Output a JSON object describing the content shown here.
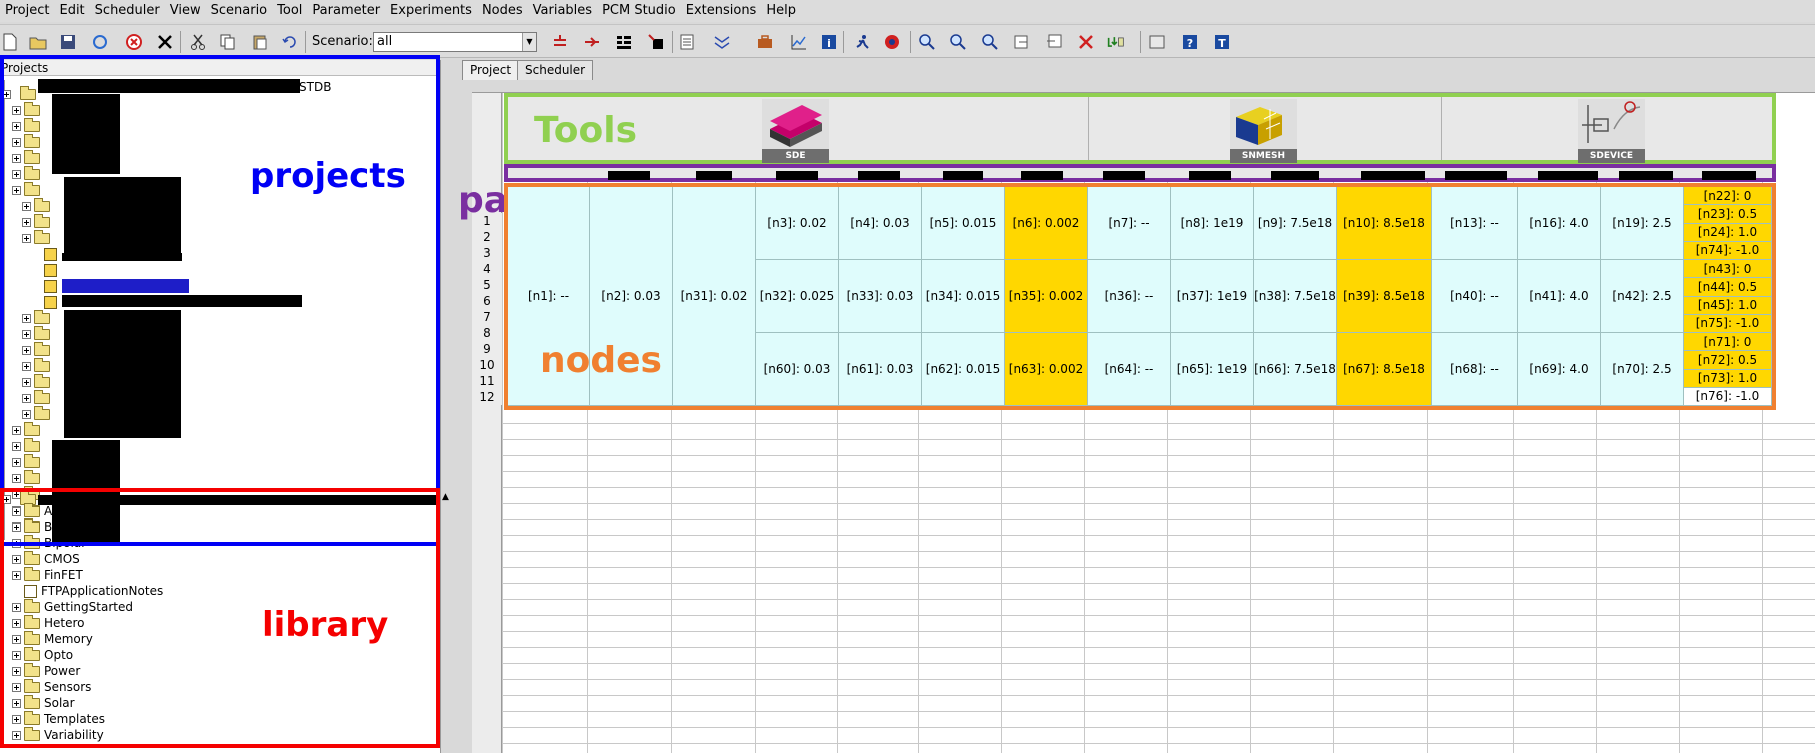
{
  "menu": [
    "Project",
    "Edit",
    "Scheduler",
    "View",
    "Scenario",
    "Tool",
    "Parameter",
    "Experiments",
    "Nodes",
    "Variables",
    "PCM Studio",
    "Extensions",
    "Help"
  ],
  "toolbar": {
    "scenario_label": "Scenario:",
    "scenario_value": "all"
  },
  "projects_pane": {
    "header": "Projects",
    "root_suffix": "STDB"
  },
  "library": {
    "items": [
      "Analog",
      "Backend",
      "Bipolar",
      "CMOS",
      "FinFET",
      "FTPApplicationNotes",
      "GettingStarted",
      "Hetero",
      "Memory",
      "Opto",
      "Power",
      "Sensors",
      "Solar",
      "Templates",
      "Variability"
    ]
  },
  "tabs": [
    "Project",
    "Scheduler"
  ],
  "overlays": {
    "projects": "projects",
    "library": "library",
    "tools": "Tools",
    "parameters": "parameters",
    "nodes": "nodes"
  },
  "colors": {
    "projects": "#0000f5",
    "library": "#f50000",
    "tools": "#90d050",
    "parameters": "#7a2fa0",
    "nodes": "#f08030",
    "node_bg": "#dffcfc",
    "node_highlight": "#ffd700"
  },
  "tools": [
    {
      "label": "SDE",
      "icon": "sde-icon"
    },
    {
      "label": "SNMESH",
      "icon": "snmesh-icon"
    },
    {
      "label": "SDEVICE",
      "icon": "sdevice-icon"
    }
  ],
  "row_numbers": [
    "1",
    "2",
    "3",
    "4",
    "5",
    "6",
    "7",
    "8",
    "9",
    "10",
    "11",
    "12"
  ],
  "nodes": {
    "n1": "[n1]: --",
    "n2": "[n2]: 0.03",
    "n31": "[n31]: 0.02",
    "row1": [
      "[n3]: 0.02",
      "[n4]: 0.03",
      "[n5]: 0.015",
      "[n6]: 0.002",
      "[n7]: --",
      "[n8]: 1e19",
      "[n9]: 7.5e18",
      "[n10]: 8.5e18",
      "[n13]: --",
      "[n16]: 4.0",
      "[n19]: 2.5"
    ],
    "row2": [
      "[n32]: 0.025",
      "[n33]: 0.03",
      "[n34]: 0.015",
      "[n35]: 0.002",
      "[n36]: --",
      "[n37]: 1e19",
      "[n38]: 7.5e18",
      "[n39]: 8.5e18",
      "[n40]: --",
      "[n41]: 4.0",
      "[n42]: 2.5"
    ],
    "row3": [
      "[n60]: 0.03",
      "[n61]: 0.03",
      "[n62]: 0.015",
      "[n63]: 0.002",
      "[n64]: --",
      "[n65]: 1e19",
      "[n66]: 7.5e18",
      "[n67]: 8.5e18",
      "[n68]: --",
      "[n69]: 4.0",
      "[n70]: 2.5"
    ],
    "last": [
      "[n22]: 0",
      "[n23]: 0.5",
      "[n24]: 1.0",
      "[n74]: -1.0",
      "[n43]: 0",
      "[n44]: 0.5",
      "[n45]: 1.0",
      "[n75]: -1.0",
      "[n71]: 0",
      "[n72]: 0.5",
      "[n73]: 1.0",
      "[n76]: -1.0"
    ]
  }
}
